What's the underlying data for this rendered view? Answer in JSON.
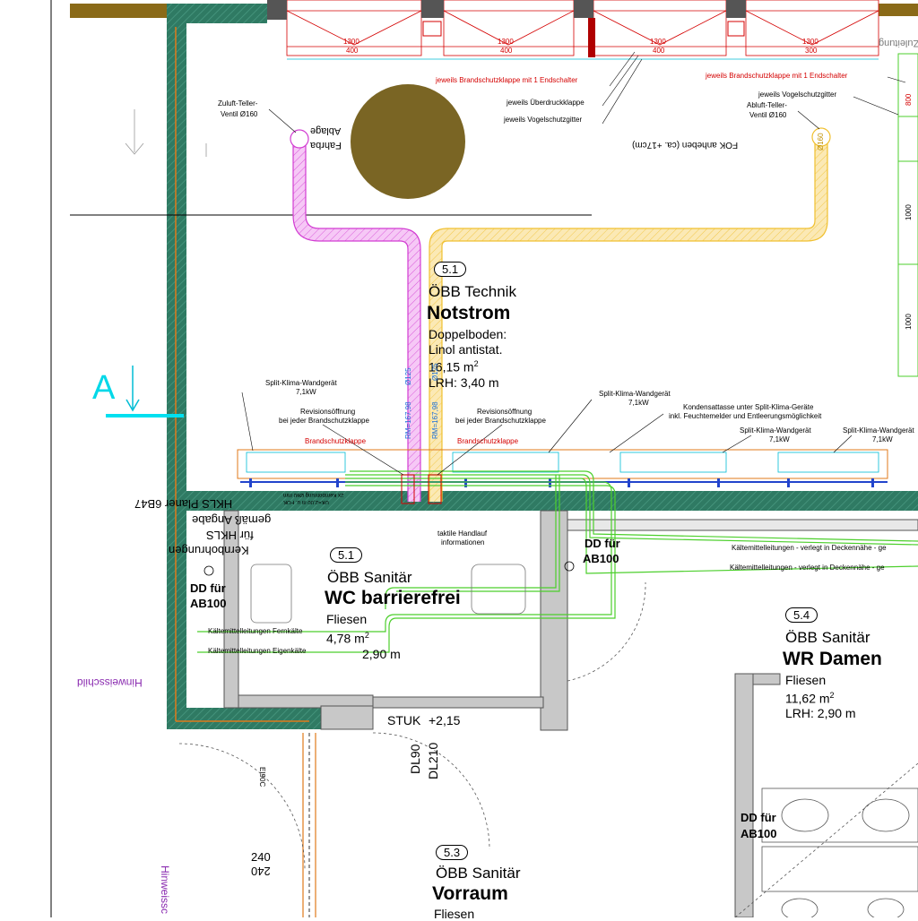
{
  "rooms": {
    "technik": {
      "no": "5.1",
      "dept": "ÖBB Technik",
      "name": "Notstrom",
      "floor_label": "Doppelboden:",
      "floor": "Linol antistat.",
      "area": "16,15 m",
      "lrh_label": "LRH:",
      "lrh": "3,40 m"
    },
    "wc": {
      "no": "5.1",
      "dept": "ÖBB Sanitär",
      "name": "WC barrierefrei",
      "floor": "Fliesen",
      "area": "4,78 m",
      "lrh": "2,90 m"
    },
    "damen": {
      "no": "5.4",
      "dept": "ÖBB Sanitär",
      "name": "WR Damen",
      "floor": "Fliesen",
      "area": "11,62 m",
      "lrh_label": "LRH:",
      "lrh": "2,90 m"
    },
    "vorraum": {
      "no": "5.3",
      "dept": "ÖBB Sanitär",
      "name": "Vorraum",
      "floor": "Fliesen"
    }
  },
  "labels": {
    "brandschutz_top": "jeweils Brandschutzklappe mit 1 Endschalter",
    "brandschutz_top_right": "jeweils Brandschutzklappe mit 1 Endschalter",
    "ueberdruck": "jeweils Überdruckklappe",
    "vogel_left": "jeweils Vogelschutzgitter",
    "vogel_right": "jeweils Vogelschutzgitter",
    "zuluft_1": "Zuluft-Teller-",
    "zuluft_2": "Ventil Ø160",
    "abluft_1": "Abluft-Teller-",
    "abluft_2": "Ventil Ø160",
    "fok": "FOK anheben (ca. +17cm)",
    "split1_a": "Split-Klima-Wandgerät",
    "split1_b": "7,1kW",
    "split2_a": "Split-Klima-Wandgerät",
    "split2_b": "7,1kW",
    "split3_a": "Split-Klima-Wandgerät",
    "split3_b": "7,1kW",
    "split4_a": "Split-Klima-Wandgerät",
    "split4_b": "7,1kW",
    "kond_a": "Kondensattasse unter Split-Klima-Geräte",
    "kond_b": "inkl. Feuchtemelder und Entleerungsmöglichkeit",
    "revision_l_a": "Revisionsöffnung",
    "revision_l_b": "bei jeder Brandschutzklappe",
    "revision_r_a": "Revisionsöffnung",
    "revision_r_b": "bei jeder Brandschutzklappe",
    "bsk_l": "Brandschutzklappe",
    "bsk_r": "Brandschutzklappe",
    "kaelte_top_1": "Kältemittelleitungen - verlegt in Deckennähe - ge",
    "kaelte_top_2": "Kältemittelleitungen - verlegt in Deckennähe - ge",
    "kaelte_fern": "Kältemittelleitungen Fernkälte",
    "kaelte_eigen": "Kältemittelleitungen Eigenkälte",
    "taktile_a": "taktile Handlauf",
    "taktile_b": "informationen",
    "dd_left_a": "DD für",
    "dd_left_b": "AB100",
    "dd_right_a": "DD für",
    "dd_right_b": "AB100",
    "dd_mid_a": "DD für",
    "dd_mid_b": "AB100",
    "kern_1": "HKLS Planer 6B47",
    "kern_2": "gemäß Angabe",
    "kern_3": "für HKLS",
    "kern_4": "Kernbohrungen",
    "hinweis_1": "Hinweisschild",
    "hinweis_2": "Hinweissc",
    "stuk": "STUK",
    "stuk_val": "+2,15",
    "dl90": "DL90",
    "dl210": "DL210",
    "ei90c": "EI90C",
    "d240_a": "240",
    "d240_b": "240",
    "section": "A",
    "rm_left": "RM=167,98",
    "rm_right": "RM=167,98",
    "d125_left": "Ø125",
    "d125_right": "Ø125",
    "d160": "Ø160",
    "fahrb": "Fahrba",
    "ablage": "Ablage",
    "zuleitung": "Zuleitung",
    "h1000a": "1000",
    "h1000b": "1000",
    "h800": "800",
    "dim_1300_a": "1300",
    "dim_400_a": "400",
    "dim_1300_b": "1300",
    "dim_400_b": "400",
    "dim_1300_c": "1300",
    "dim_400_c": "400",
    "dim_1300_d": "1300",
    "dim_300_d": "300",
    "m2_sup": "2",
    "kanal_note_a": "2x Kernbohrung Ø60 mm",
    "kanal_note_b": "UK=2,00 m ü. FOK"
  },
  "colors": {
    "wall": "#2f7a63",
    "zuluft": "#d23cd2",
    "abluft": "#f0c030",
    "kaelte": "#4ccf2c",
    "orange": "#e07a1a",
    "dimension": "#d40000",
    "cyan": "#00e0f0",
    "brown_disc": "#7a6524"
  }
}
